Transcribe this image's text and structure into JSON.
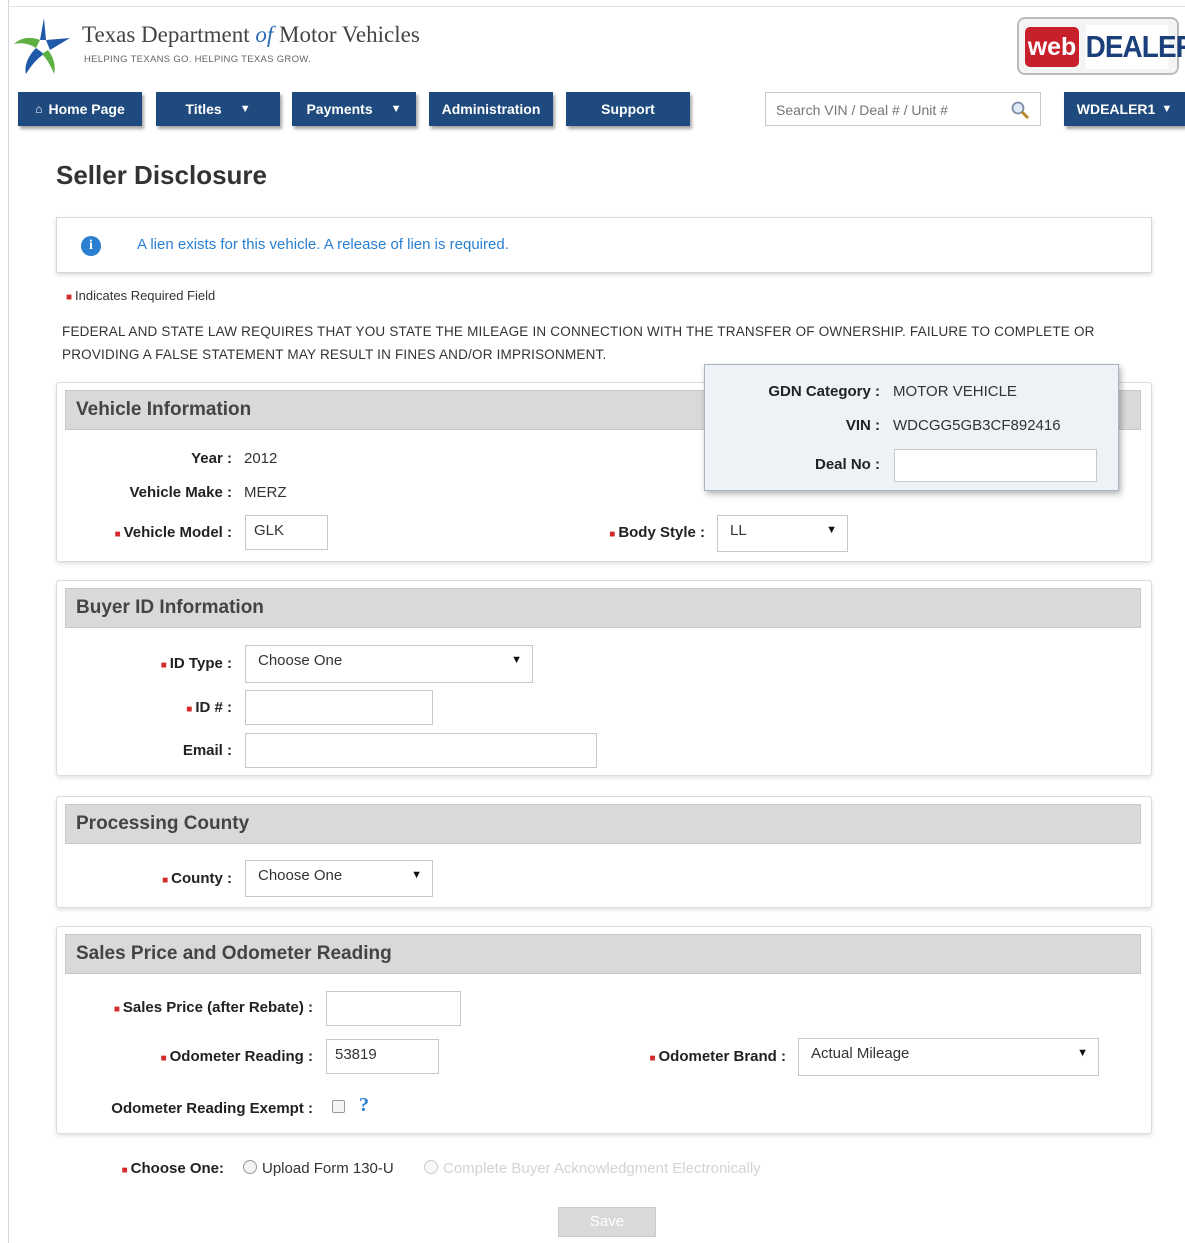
{
  "header": {
    "brand_title_part1": "Texas Department ",
    "brand_title_of": "of",
    "brand_title_part2": " Motor Vehicles",
    "brand_tagline": "HELPING TEXANS GO. HELPING TEXAS GROW.",
    "logo_web": "web",
    "logo_dealer": "DEALER"
  },
  "nav": {
    "home": "Home Page",
    "titles": "Titles",
    "payments": "Payments",
    "administration": "Administration",
    "support": "Support",
    "search_placeholder": "Search VIN / Deal # / Unit #",
    "user": "WDEALER1"
  },
  "page": {
    "title": "Seller Disclosure",
    "info_message": "A lien exists for this vehicle. A release of lien is required.",
    "required_note": "Indicates Required Field",
    "legal_text": "FEDERAL AND STATE LAW REQUIRES THAT YOU STATE THE MILEAGE IN CONNECTION WITH THE TRANSFER OF OWNERSHIP. FAILURE TO COMPLETE OR PROVIDING A FALSE STATEMENT MAY RESULT IN FINES AND/OR IMPRISONMENT."
  },
  "popover": {
    "gdn_label": "GDN Category :",
    "gdn_value": "MOTOR VEHICLE",
    "vin_label": "VIN :",
    "vin_value": "WDCGG5GB3CF892416",
    "deal_label": "Deal No :",
    "deal_value": ""
  },
  "vehicle": {
    "heading": "Vehicle Information",
    "year_label": "Year :",
    "year_value": "2012",
    "make_label": "Vehicle Make :",
    "make_value": "MERZ",
    "model_label": "Vehicle Model :",
    "model_value": "GLK",
    "body_label": "Body Style :",
    "body_value": "LL"
  },
  "buyer": {
    "heading": "Buyer ID Information",
    "idtype_label": "ID Type :",
    "idtype_value": "Choose One",
    "idnum_label": "ID # :",
    "idnum_value": "",
    "email_label": "Email :",
    "email_value": ""
  },
  "county": {
    "heading": "Processing County",
    "label": "County :",
    "value": "Choose One"
  },
  "sales": {
    "heading": "Sales Price and Odometer Reading",
    "price_label": "Sales Price (after Rebate) :",
    "price_value": "",
    "odo_label": "Odometer Reading :",
    "odo_value": "53819",
    "brand_label": "Odometer Brand :",
    "brand_value": "Actual Mileage",
    "exempt_label": "Odometer Reading Exempt :"
  },
  "choose": {
    "label": "Choose One:",
    "option1": "Upload Form 130-U",
    "option2": "Complete Buyer Acknowledgment Electronically",
    "save": "Save"
  },
  "colors": {
    "nav_blue": "#1e4a7e",
    "required_red": "#d42a2a",
    "info_blue": "#2a7fd0",
    "logo_red": "#c8202a"
  }
}
